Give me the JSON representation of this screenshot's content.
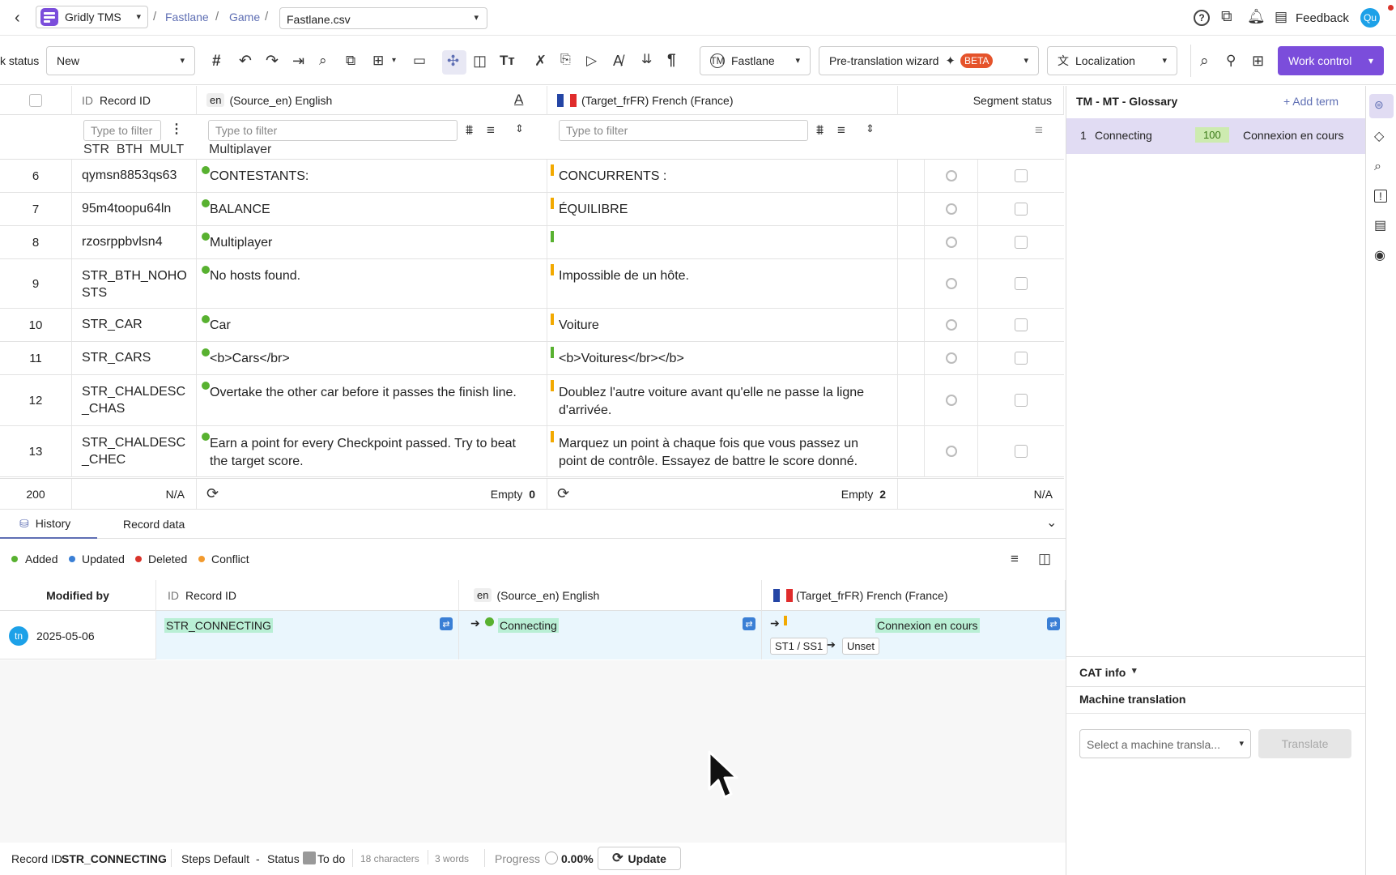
{
  "topbar": {
    "app_name": "Gridly TMS",
    "crumbs": [
      "Fastlane",
      "Game"
    ],
    "file": "Fastlane.csv",
    "feedback": "Feedback",
    "avatar": "Qu"
  },
  "toolbar": {
    "status_label": "k status",
    "status_value": "New",
    "fastlane": "Fastlane",
    "pretranslation": "Pre-translation wizard",
    "beta": "BETA",
    "localization": "Localization",
    "work_control": "Work control"
  },
  "grid": {
    "headers": {
      "record_id_prefix": "ID",
      "record_id": "Record ID",
      "source_prefix": "en",
      "source": "(Source_en)  English",
      "target": "(Target_frFR)  French (France)",
      "segment_status": "Segment status"
    },
    "filter_placeholder": "Type to filter",
    "rows": [
      {
        "n": "6",
        "id": "qymsn8853qs63",
        "src": "CONTESTANTS:",
        "tgt": "CONCURRENTS :",
        "mark": "o"
      },
      {
        "n": "7",
        "id": "95m4toopu64ln",
        "src": "BALANCE",
        "tgt": "ÉQUILIBRE",
        "mark": "o"
      },
      {
        "n": "8",
        "id": "rzosrppbvlsn4",
        "src": "Multiplayer",
        "tgt": "",
        "mark": "g"
      },
      {
        "n": "9",
        "id": "STR_BTH_NOHO STS",
        "src": "No hosts found.",
        "tgt": "Impossible de un hôte.",
        "mark": "o"
      },
      {
        "n": "10",
        "id": "STR_CAR",
        "src": "Car",
        "tgt": "Voiture",
        "mark": "o"
      },
      {
        "n": "11",
        "id": "STR_CARS",
        "src": "<b>Cars</br>",
        "tgt": "<b>Voitures</br></b>",
        "mark": "g"
      },
      {
        "n": "12",
        "id": "STR_CHALDESC _CHAS",
        "src": "Overtake the other car before it passes the finish line.",
        "tgt": "Doublez l'autre voiture avant qu'elle ne passe la ligne d'arrivée.",
        "mark": "o"
      },
      {
        "n": "13",
        "id": "STR_CHALDESC _CHEC",
        "src": "Earn a point for every Checkpoint passed. Try to beat the target score.",
        "tgt": "Marquez un point à chaque fois que vous passez un point de contrôle. Essayez de battre le score donné.",
        "mark": "o"
      }
    ],
    "partial_top": {
      "id": "STR_BTH_MULT",
      "src": "Multiplayer"
    },
    "footer": {
      "count": "200",
      "na1": "N/A",
      "empty_label": "Empty",
      "empty_src": "0",
      "empty_tgt": "2",
      "na2": "N/A"
    }
  },
  "history": {
    "tabs": [
      "History",
      "Record data"
    ],
    "legend": [
      "Added",
      "Updated",
      "Deleted",
      "Conflict"
    ],
    "headers": {
      "modified_by": "Modified by",
      "record_prefix": "ID",
      "record": "Record ID",
      "source_prefix": "en",
      "source": "(Source_en)  English",
      "target": "(Target_frFR)  French (France)"
    },
    "row": {
      "avatar": "tn",
      "date": "2025-05-06",
      "record": "STR_CONNECTING",
      "source": "Connecting",
      "target": "Connexion en cours",
      "step": "ST1 / SS1",
      "unset": "Unset"
    }
  },
  "side": {
    "title": "TM - MT - Glossary",
    "add_term": "+ Add term",
    "match": {
      "n": "1",
      "src": "Connecting",
      "score": "100",
      "tgt": "Connexion en cours"
    },
    "cat_info": "CAT info",
    "mt_title": "Machine translation",
    "mt_select": "Select a machine transla...",
    "translate": "Translate"
  },
  "statusbar": {
    "record_label": "Record ID",
    "record": "STR_CONNECTING",
    "steps": "Steps Default",
    "dash": "-",
    "status_label": "Status",
    "todo": "To do",
    "chars": "18 characters",
    "words": "3 words",
    "progress_label": "Progress",
    "progress": "0.00%",
    "update": "Update"
  },
  "colors": {
    "accent": "#7b4ddb",
    "green": "#58b130",
    "orange": "#f2a900",
    "blue": "#3a7fd5",
    "red": "#d9342b"
  }
}
